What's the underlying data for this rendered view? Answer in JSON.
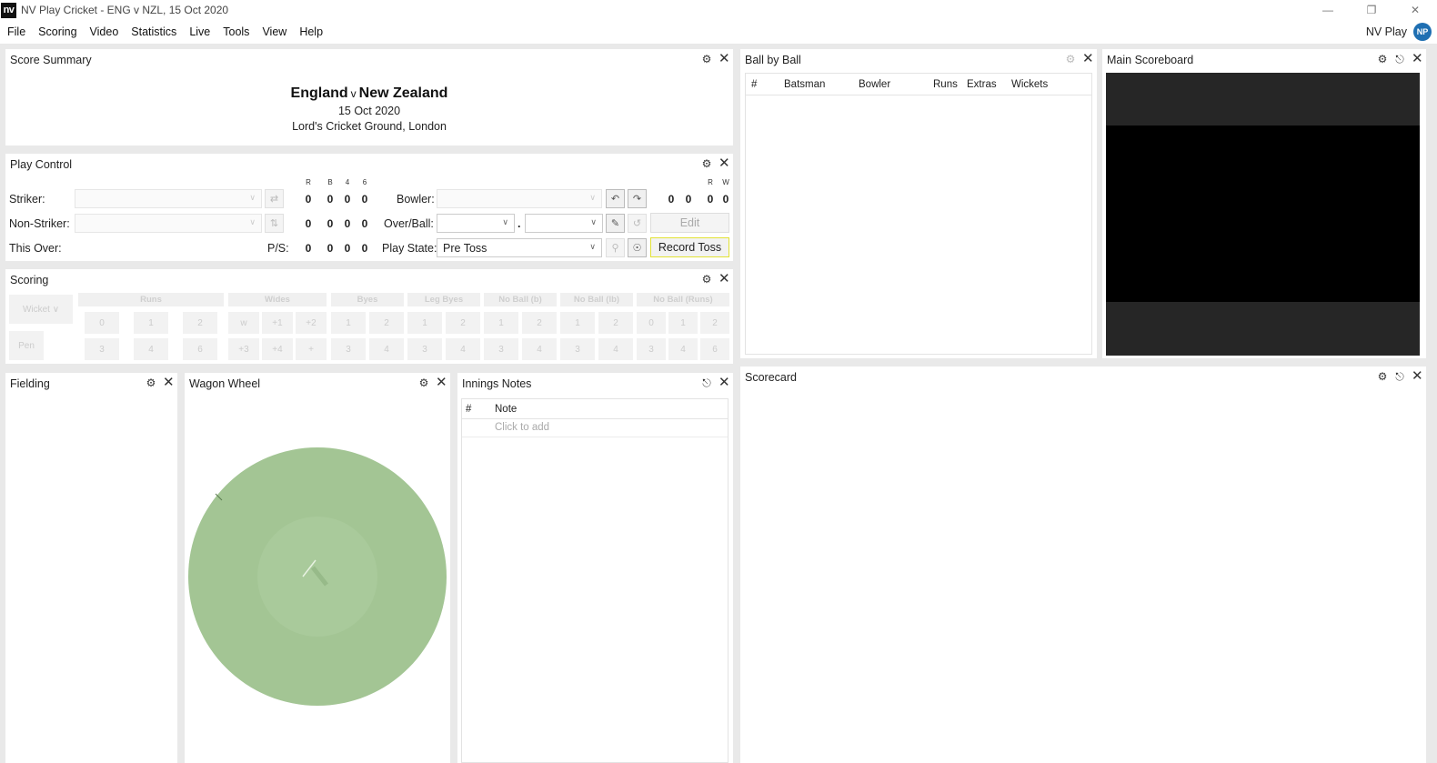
{
  "app": {
    "title": "NV Play Cricket - ENG v NZL, 15 Oct 2020",
    "logo": "nv",
    "window_controls": [
      "minimize-icon",
      "restore-icon",
      "close-icon"
    ]
  },
  "menu": [
    "File",
    "Scoring",
    "Video",
    "Statistics",
    "Live",
    "Tools",
    "View",
    "Help"
  ],
  "account": {
    "name": "NV Play",
    "initials": "NP"
  },
  "score_summary": {
    "title": "Score Summary",
    "team1": "England",
    "vs": "v",
    "team2": "New Zealand",
    "date": "15 Oct 2020",
    "venue": "Lord's Cricket Ground, London"
  },
  "play_control": {
    "title": "Play Control",
    "striker_label": "Striker:",
    "nonstriker_label": "Non-Striker:",
    "thisover_label": "This Over:",
    "ps_label": "P/S:",
    "bat_headers": [
      "R",
      "B",
      "4",
      "6"
    ],
    "striker_stats": [
      "0",
      "0",
      "0",
      "0"
    ],
    "nonstriker_stats": [
      "0",
      "0",
      "0",
      "0"
    ],
    "ps_stats": [
      "0",
      "0",
      "0",
      "0"
    ],
    "bowler_label": "Bowler:",
    "overball_label": "Over/Ball:",
    "playstate_label": "Play State:",
    "playstate_value": "Pre Toss",
    "bowl_headers": [
      "R",
      "W"
    ],
    "bowler_stats": [
      "0",
      "0",
      "0",
      "0"
    ],
    "dot": ".",
    "edit_label": "Edit",
    "record_toss_label": "Record Toss",
    "highlight_color": "#e2e235"
  },
  "scoring": {
    "title": "Scoring",
    "wicket_label": "Wicket",
    "pen_label": "Pen",
    "groups": [
      {
        "label": "Runs",
        "top": [
          "0",
          "1",
          "2"
        ],
        "bottom": [
          "3",
          "4",
          "6"
        ]
      },
      {
        "label": "Wides",
        "top": [
          "w",
          "+1",
          "+2"
        ],
        "bottom": [
          "+3",
          "+4",
          "+"
        ]
      },
      {
        "label": "Byes",
        "top": [
          "1",
          "2"
        ],
        "bottom": [
          "3",
          "4"
        ]
      },
      {
        "label": "Leg Byes",
        "top": [
          "1",
          "2"
        ],
        "bottom": [
          "3",
          "4"
        ]
      },
      {
        "label": "No Ball (b)",
        "top": [
          "1",
          "2"
        ],
        "bottom": [
          "3",
          "4"
        ]
      },
      {
        "label": "No Ball (lb)",
        "top": [
          "1",
          "2"
        ],
        "bottom": [
          "3",
          "4"
        ]
      },
      {
        "label": "No Ball (Runs)",
        "top": [
          "0",
          "1",
          "2"
        ],
        "bottom": [
          "3",
          "4",
          "6"
        ]
      }
    ]
  },
  "ball_by_ball": {
    "title": "Ball by Ball",
    "columns": [
      "#",
      "Batsman",
      "Bowler",
      "Runs",
      "Extras",
      "Wickets"
    ]
  },
  "main_scoreboard": {
    "title": "Main Scoreboard"
  },
  "fielding": {
    "title": "Fielding"
  },
  "wagon_wheel": {
    "title": "Wagon Wheel",
    "field_color": "#a3c594"
  },
  "innings_notes": {
    "title": "Innings Notes",
    "columns": [
      "#",
      "Note"
    ],
    "placeholder": "Click to add"
  },
  "scorecard": {
    "title": "Scorecard"
  },
  "icons": {
    "settings": "gear-icon",
    "close": "close-icon",
    "pin": "pin-icon"
  }
}
